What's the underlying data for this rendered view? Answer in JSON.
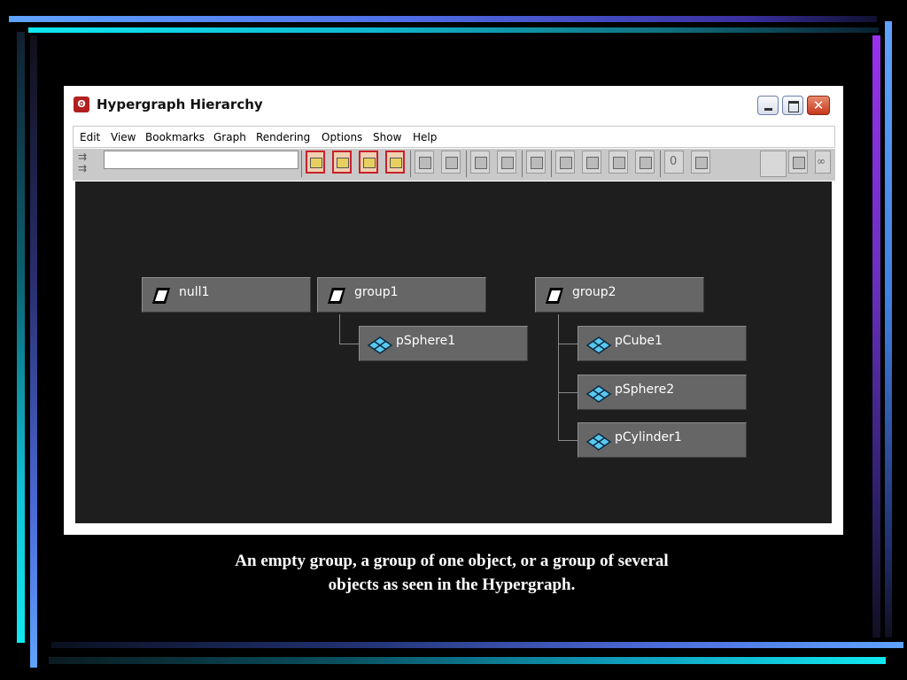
{
  "window": {
    "title": "Hypergraph Hierarchy",
    "app_icon_glyph": "Ꙩ"
  },
  "menu": {
    "items": [
      "Edit",
      "View",
      "Bookmarks",
      "Graph",
      "Rendering",
      "Options",
      "Show",
      "Help"
    ]
  },
  "toolbar": {
    "search_value": "",
    "counter_label": "0"
  },
  "nodes": {
    "null1": "null1",
    "group1": "group1",
    "pSphere1": "pSphere1",
    "group2": "group2",
    "pCube1": "pCube1",
    "pSphere2": "pSphere2",
    "pCylinder1": "pCylinder1"
  },
  "icons": {
    "transform": "transform-node-icon",
    "mesh": "poly-mesh-icon"
  },
  "colors": {
    "graph_background": "#1e1e1e",
    "node_fill": "#666666",
    "mesh_icon": "#5ac8f0"
  },
  "caption": {
    "line1": "An empty group, a group of one object, or a group of several",
    "line2": "objects as seen in the Hypergraph."
  }
}
